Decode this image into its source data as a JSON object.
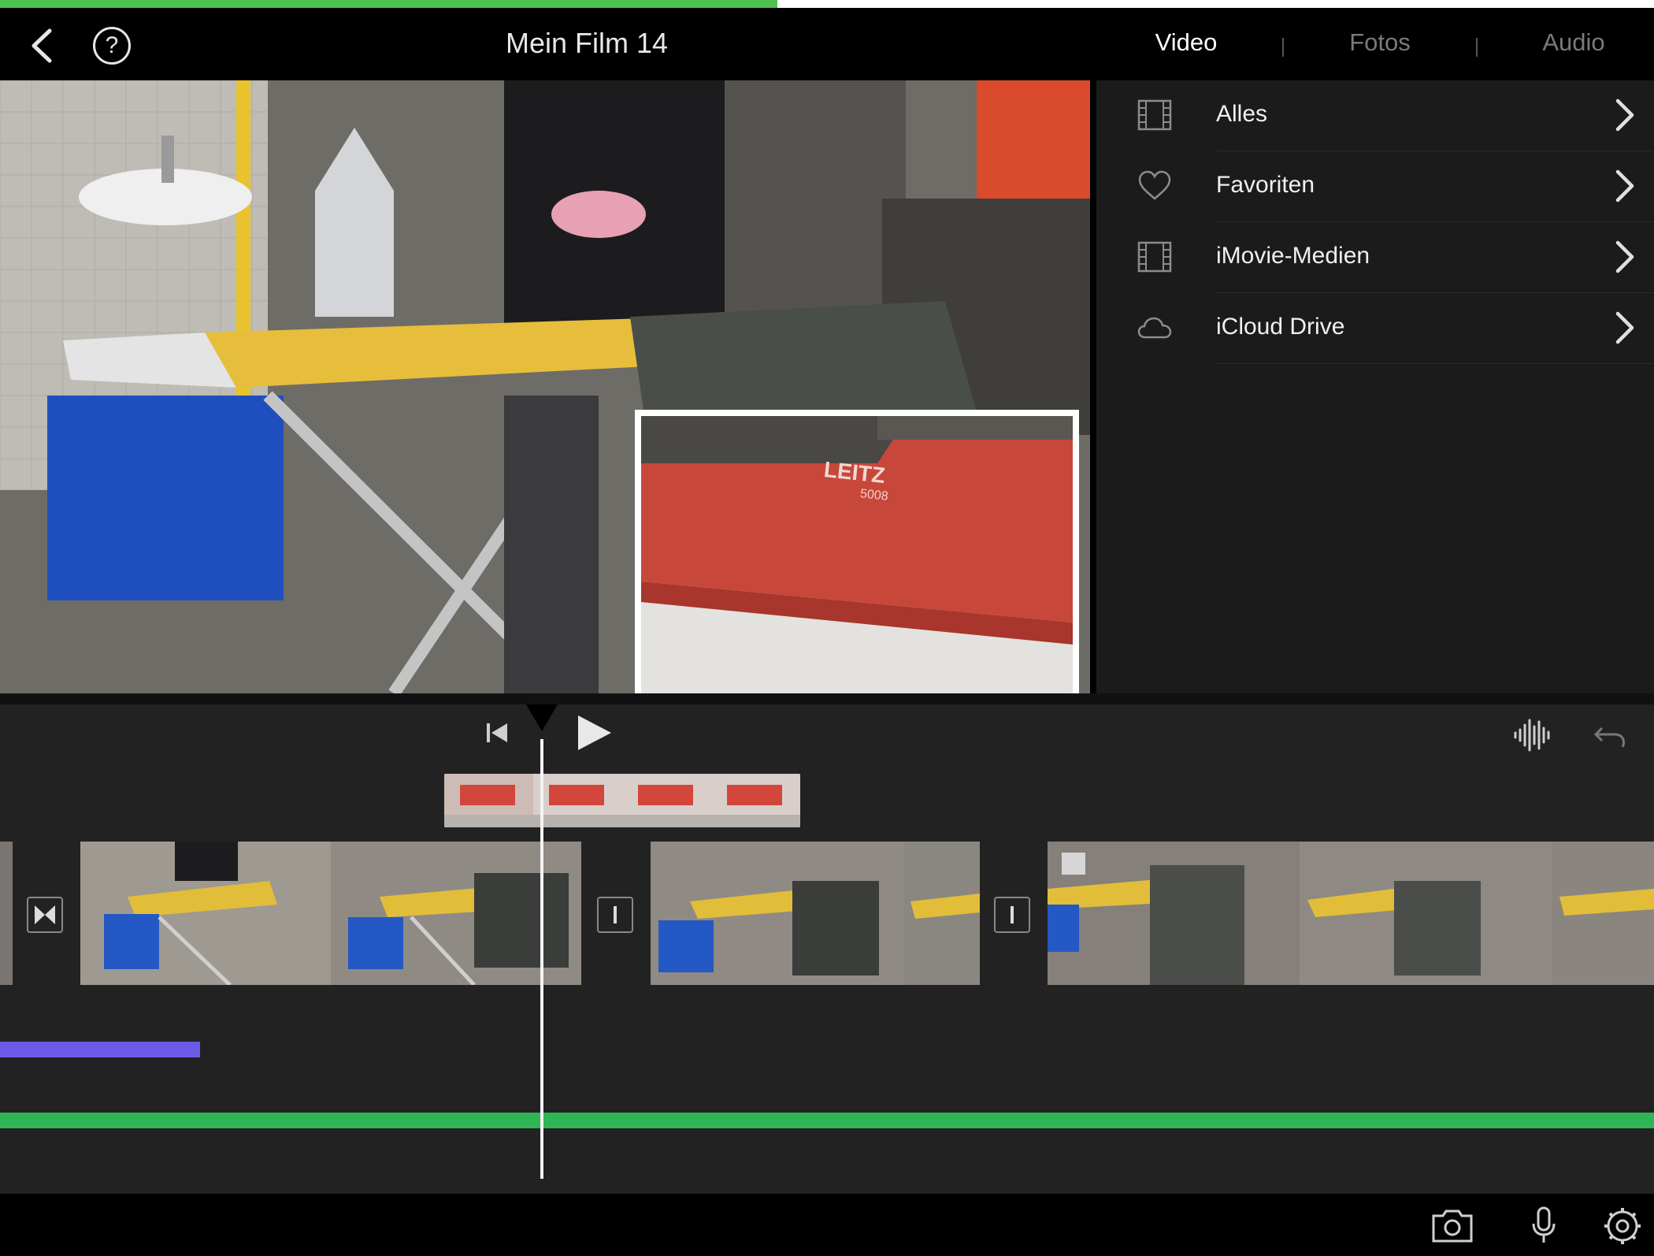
{
  "progress": {
    "fraction": 0.47
  },
  "nav": {
    "title": "Mein Film 14",
    "help_glyph": "?",
    "tabs": [
      {
        "label": "Video",
        "active": true
      },
      {
        "label": "Fotos",
        "active": false
      },
      {
        "label": "Audio",
        "active": false
      }
    ]
  },
  "browser": {
    "items": [
      {
        "label": "Alles",
        "icon": "film-icon"
      },
      {
        "label": "Favoriten",
        "icon": "heart-icon"
      },
      {
        "label": "iMovie-Medien",
        "icon": "film-icon"
      },
      {
        "label": "iCloud Drive",
        "icon": "cloud-icon"
      }
    ]
  },
  "pip": {
    "brand": "LEITZ",
    "model": "5008"
  },
  "colors": {
    "accent_green": "#4ec04e",
    "audio_purple": "#6c5be8",
    "audio_green": "#2fb555"
  },
  "toolbar": {
    "icons": [
      "camera-icon",
      "microphone-icon",
      "settings-icon"
    ]
  }
}
